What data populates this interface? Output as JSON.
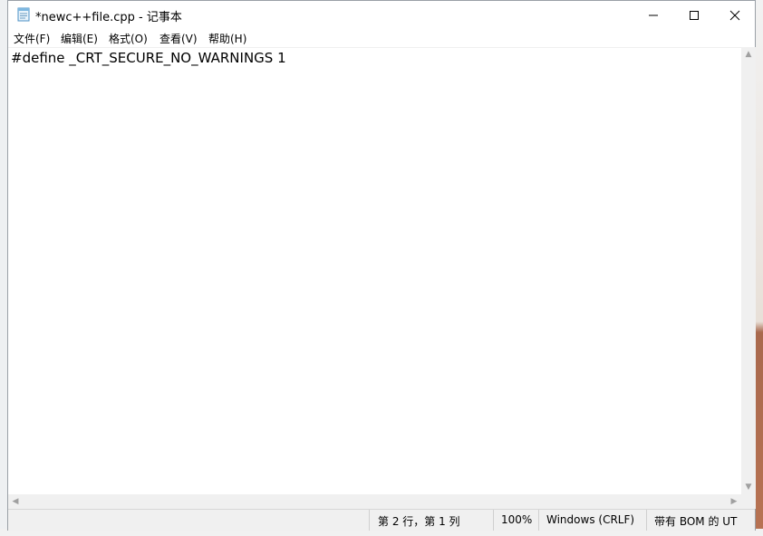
{
  "window": {
    "title": "*newc++file.cpp - 记事本",
    "app_icon": "notepad-icon",
    "controls": [
      "minimize-icon",
      "maximize-icon",
      "close-icon"
    ]
  },
  "menu": {
    "items": [
      {
        "label": "文件(F)"
      },
      {
        "label": "编辑(E)"
      },
      {
        "label": "格式(O)"
      },
      {
        "label": "查看(V)"
      },
      {
        "label": "帮助(H)"
      }
    ]
  },
  "editor": {
    "content": "#define _CRT_SECURE_NO_WARNINGS 1"
  },
  "status": {
    "position": "第 2 行，第 1 列",
    "zoom": "100%",
    "line_ending": "Windows (CRLF)",
    "encoding": "带有 BOM 的 UT"
  }
}
